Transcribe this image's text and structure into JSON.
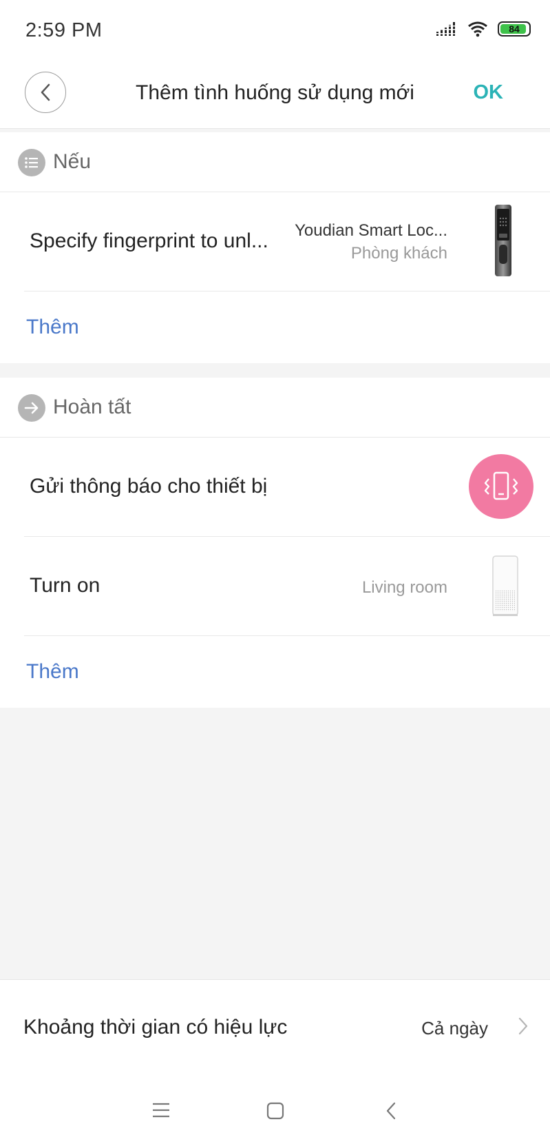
{
  "status_bar": {
    "time": "2:59  PM",
    "battery_level": "84",
    "icons": [
      "signal-icon",
      "wifi-icon",
      "battery-icon"
    ]
  },
  "header": {
    "title": "Thêm tình huống sử dụng mới",
    "ok_label": "OK",
    "back_icon": "chevron-left-icon"
  },
  "if_section": {
    "title": "Nếu",
    "icon": "list-icon",
    "items": [
      {
        "label": "Specify fingerprint to unl...",
        "device": "Youdian Smart Loc...",
        "room": "Phòng khách",
        "thumb": "smart-lock-thumbnail"
      }
    ],
    "add_label": "Thêm"
  },
  "then_section": {
    "title": "Hoàn tất",
    "icon": "arrow-right-icon",
    "items": [
      {
        "label": "Gửi thông báo cho thiết bị",
        "thumb": "phone-vibrate-icon",
        "thumb_color": "#f27aa2"
      },
      {
        "label": "Turn on",
        "room": "Living room",
        "thumb": "air-purifier-thumbnail"
      }
    ],
    "add_label": "Thêm"
  },
  "validity": {
    "label": "Khoảng thời gian có hiệu lực",
    "value": "Cả ngày"
  },
  "navbar": [
    "menu-icon",
    "home-icon",
    "back-icon"
  ],
  "colors": {
    "accent_ok": "#2bb3b6",
    "link": "#4a78c9",
    "notify": "#f27aa2",
    "battery": "#3ec24a"
  }
}
